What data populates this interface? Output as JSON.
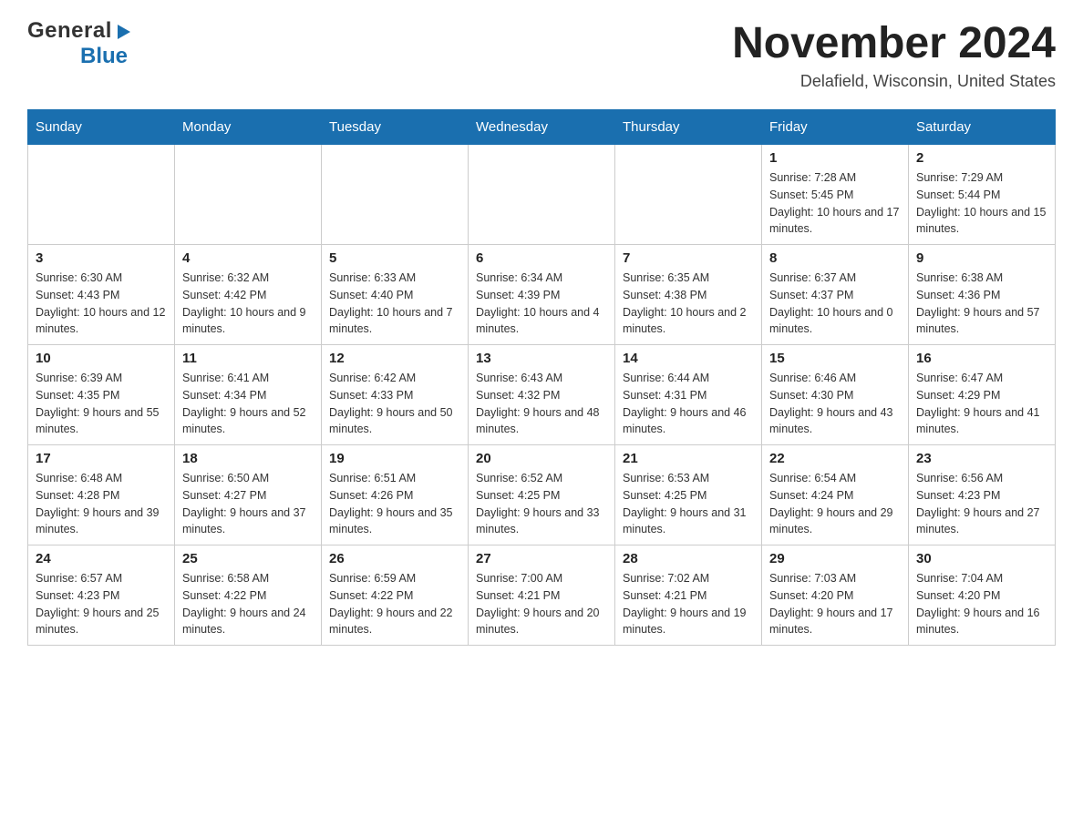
{
  "header": {
    "logo_general": "General",
    "logo_blue": "Blue",
    "title": "November 2024",
    "subtitle": "Delafield, Wisconsin, United States"
  },
  "days_of_week": [
    "Sunday",
    "Monday",
    "Tuesday",
    "Wednesday",
    "Thursday",
    "Friday",
    "Saturday"
  ],
  "weeks": [
    [
      {
        "day": "",
        "sunrise": "",
        "sunset": "",
        "daylight": ""
      },
      {
        "day": "",
        "sunrise": "",
        "sunset": "",
        "daylight": ""
      },
      {
        "day": "",
        "sunrise": "",
        "sunset": "",
        "daylight": ""
      },
      {
        "day": "",
        "sunrise": "",
        "sunset": "",
        "daylight": ""
      },
      {
        "day": "",
        "sunrise": "",
        "sunset": "",
        "daylight": ""
      },
      {
        "day": "1",
        "sunrise": "Sunrise: 7:28 AM",
        "sunset": "Sunset: 5:45 PM",
        "daylight": "Daylight: 10 hours and 17 minutes."
      },
      {
        "day": "2",
        "sunrise": "Sunrise: 7:29 AM",
        "sunset": "Sunset: 5:44 PM",
        "daylight": "Daylight: 10 hours and 15 minutes."
      }
    ],
    [
      {
        "day": "3",
        "sunrise": "Sunrise: 6:30 AM",
        "sunset": "Sunset: 4:43 PM",
        "daylight": "Daylight: 10 hours and 12 minutes."
      },
      {
        "day": "4",
        "sunrise": "Sunrise: 6:32 AM",
        "sunset": "Sunset: 4:42 PM",
        "daylight": "Daylight: 10 hours and 9 minutes."
      },
      {
        "day": "5",
        "sunrise": "Sunrise: 6:33 AM",
        "sunset": "Sunset: 4:40 PM",
        "daylight": "Daylight: 10 hours and 7 minutes."
      },
      {
        "day": "6",
        "sunrise": "Sunrise: 6:34 AM",
        "sunset": "Sunset: 4:39 PM",
        "daylight": "Daylight: 10 hours and 4 minutes."
      },
      {
        "day": "7",
        "sunrise": "Sunrise: 6:35 AM",
        "sunset": "Sunset: 4:38 PM",
        "daylight": "Daylight: 10 hours and 2 minutes."
      },
      {
        "day": "8",
        "sunrise": "Sunrise: 6:37 AM",
        "sunset": "Sunset: 4:37 PM",
        "daylight": "Daylight: 10 hours and 0 minutes."
      },
      {
        "day": "9",
        "sunrise": "Sunrise: 6:38 AM",
        "sunset": "Sunset: 4:36 PM",
        "daylight": "Daylight: 9 hours and 57 minutes."
      }
    ],
    [
      {
        "day": "10",
        "sunrise": "Sunrise: 6:39 AM",
        "sunset": "Sunset: 4:35 PM",
        "daylight": "Daylight: 9 hours and 55 minutes."
      },
      {
        "day": "11",
        "sunrise": "Sunrise: 6:41 AM",
        "sunset": "Sunset: 4:34 PM",
        "daylight": "Daylight: 9 hours and 52 minutes."
      },
      {
        "day": "12",
        "sunrise": "Sunrise: 6:42 AM",
        "sunset": "Sunset: 4:33 PM",
        "daylight": "Daylight: 9 hours and 50 minutes."
      },
      {
        "day": "13",
        "sunrise": "Sunrise: 6:43 AM",
        "sunset": "Sunset: 4:32 PM",
        "daylight": "Daylight: 9 hours and 48 minutes."
      },
      {
        "day": "14",
        "sunrise": "Sunrise: 6:44 AM",
        "sunset": "Sunset: 4:31 PM",
        "daylight": "Daylight: 9 hours and 46 minutes."
      },
      {
        "day": "15",
        "sunrise": "Sunrise: 6:46 AM",
        "sunset": "Sunset: 4:30 PM",
        "daylight": "Daylight: 9 hours and 43 minutes."
      },
      {
        "day": "16",
        "sunrise": "Sunrise: 6:47 AM",
        "sunset": "Sunset: 4:29 PM",
        "daylight": "Daylight: 9 hours and 41 minutes."
      }
    ],
    [
      {
        "day": "17",
        "sunrise": "Sunrise: 6:48 AM",
        "sunset": "Sunset: 4:28 PM",
        "daylight": "Daylight: 9 hours and 39 minutes."
      },
      {
        "day": "18",
        "sunrise": "Sunrise: 6:50 AM",
        "sunset": "Sunset: 4:27 PM",
        "daylight": "Daylight: 9 hours and 37 minutes."
      },
      {
        "day": "19",
        "sunrise": "Sunrise: 6:51 AM",
        "sunset": "Sunset: 4:26 PM",
        "daylight": "Daylight: 9 hours and 35 minutes."
      },
      {
        "day": "20",
        "sunrise": "Sunrise: 6:52 AM",
        "sunset": "Sunset: 4:25 PM",
        "daylight": "Daylight: 9 hours and 33 minutes."
      },
      {
        "day": "21",
        "sunrise": "Sunrise: 6:53 AM",
        "sunset": "Sunset: 4:25 PM",
        "daylight": "Daylight: 9 hours and 31 minutes."
      },
      {
        "day": "22",
        "sunrise": "Sunrise: 6:54 AM",
        "sunset": "Sunset: 4:24 PM",
        "daylight": "Daylight: 9 hours and 29 minutes."
      },
      {
        "day": "23",
        "sunrise": "Sunrise: 6:56 AM",
        "sunset": "Sunset: 4:23 PM",
        "daylight": "Daylight: 9 hours and 27 minutes."
      }
    ],
    [
      {
        "day": "24",
        "sunrise": "Sunrise: 6:57 AM",
        "sunset": "Sunset: 4:23 PM",
        "daylight": "Daylight: 9 hours and 25 minutes."
      },
      {
        "day": "25",
        "sunrise": "Sunrise: 6:58 AM",
        "sunset": "Sunset: 4:22 PM",
        "daylight": "Daylight: 9 hours and 24 minutes."
      },
      {
        "day": "26",
        "sunrise": "Sunrise: 6:59 AM",
        "sunset": "Sunset: 4:22 PM",
        "daylight": "Daylight: 9 hours and 22 minutes."
      },
      {
        "day": "27",
        "sunrise": "Sunrise: 7:00 AM",
        "sunset": "Sunset: 4:21 PM",
        "daylight": "Daylight: 9 hours and 20 minutes."
      },
      {
        "day": "28",
        "sunrise": "Sunrise: 7:02 AM",
        "sunset": "Sunset: 4:21 PM",
        "daylight": "Daylight: 9 hours and 19 minutes."
      },
      {
        "day": "29",
        "sunrise": "Sunrise: 7:03 AM",
        "sunset": "Sunset: 4:20 PM",
        "daylight": "Daylight: 9 hours and 17 minutes."
      },
      {
        "day": "30",
        "sunrise": "Sunrise: 7:04 AM",
        "sunset": "Sunset: 4:20 PM",
        "daylight": "Daylight: 9 hours and 16 minutes."
      }
    ]
  ]
}
